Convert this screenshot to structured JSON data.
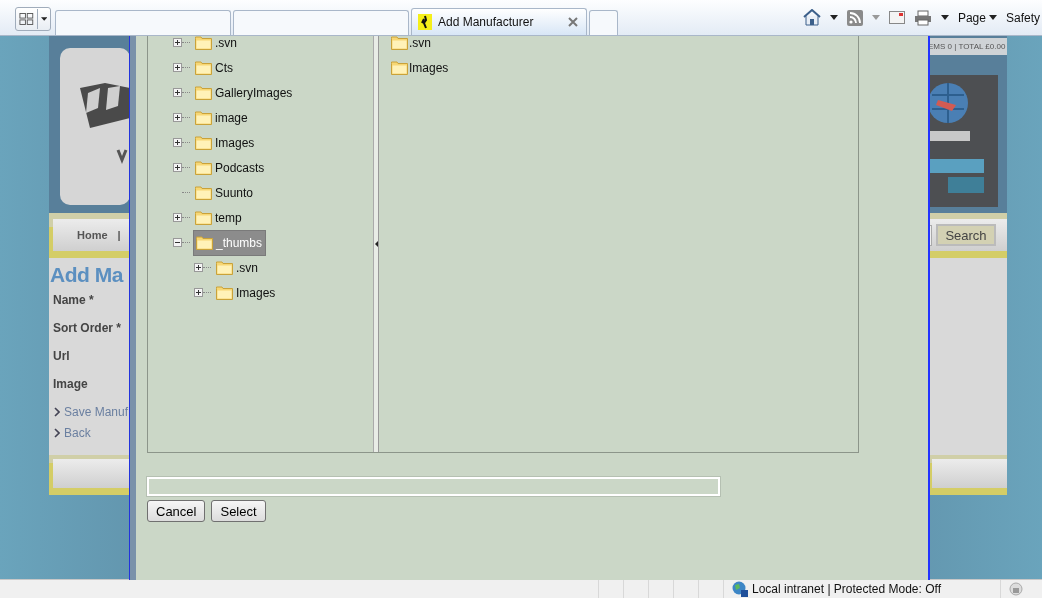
{
  "tabs": [
    {
      "selected": false
    },
    {
      "selected": false
    },
    {
      "title": "Add Manufacturer",
      "selected": true
    }
  ],
  "command_bar": {
    "page_menu": "Page",
    "safety_menu": "Safety"
  },
  "site": {
    "cart_summary": "EMS 0 | TOTAL £0.00",
    "nav": [
      "Home",
      "|"
    ],
    "search_button": "Search",
    "heading": "Add Ma",
    "form_labels": [
      "Name *",
      "Sort Order *",
      "Url",
      "Image"
    ],
    "links": [
      "Save Manuf",
      "Back"
    ]
  },
  "dialog": {
    "folder_tree": [
      {
        "name": ".svn",
        "expanded": false,
        "selected": false
      },
      {
        "name": "Cts",
        "expanded": false,
        "selected": false
      },
      {
        "name": "GalleryImages",
        "expanded": false,
        "selected": false
      },
      {
        "name": "image",
        "expanded": false,
        "selected": false
      },
      {
        "name": "Images",
        "expanded": false,
        "selected": false
      },
      {
        "name": "Podcasts",
        "expanded": false,
        "selected": false
      },
      {
        "name": "Suunto",
        "selected": false
      },
      {
        "name": "temp",
        "expanded": false,
        "selected": false
      },
      {
        "name": "_thumbs",
        "expanded": true,
        "selected": true,
        "children": [
          {
            "name": ".svn",
            "expanded": false,
            "selected": false
          },
          {
            "name": "Images",
            "expanded": false,
            "selected": false
          }
        ]
      }
    ],
    "folder_contents": [
      ".svn",
      "Images"
    ],
    "buttons": [
      "Cancel",
      "Select"
    ]
  },
  "status_bar": {
    "zone": "Local intranet | Protected Mode: Off"
  }
}
